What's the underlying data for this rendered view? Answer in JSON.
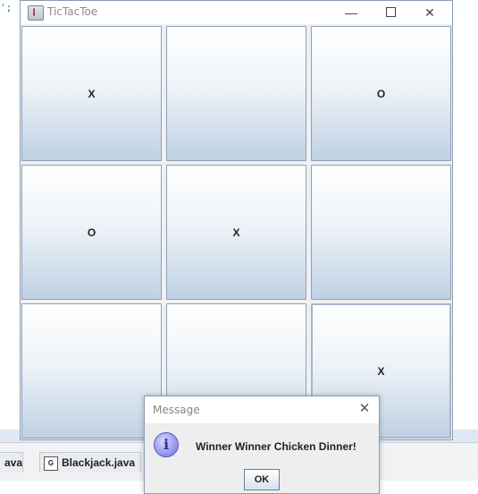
{
  "window": {
    "title": "TicTacToe",
    "minimize_glyph": "—",
    "close_glyph": "✕"
  },
  "board": {
    "cells": [
      "X",
      "",
      "O",
      "O",
      "X",
      "",
      "",
      "",
      "X"
    ]
  },
  "dialog": {
    "title": "Message",
    "close_glyph": "✕",
    "icon_glyph": "i",
    "message": "Winner Winner Chicken Dinner!",
    "ok_label": "OK"
  },
  "background": {
    "code_fragment": "';",
    "tabs": [
      {
        "label": "ava"
      },
      {
        "label": "Blackjack.java",
        "icon_glyph": "G"
      }
    ]
  },
  "colors": {
    "cell_gradient_top": "#ffffff",
    "cell_gradient_bottom": "#bfd1e4",
    "window_border": "#8c9db1",
    "info_icon": "#9d9ef0"
  }
}
